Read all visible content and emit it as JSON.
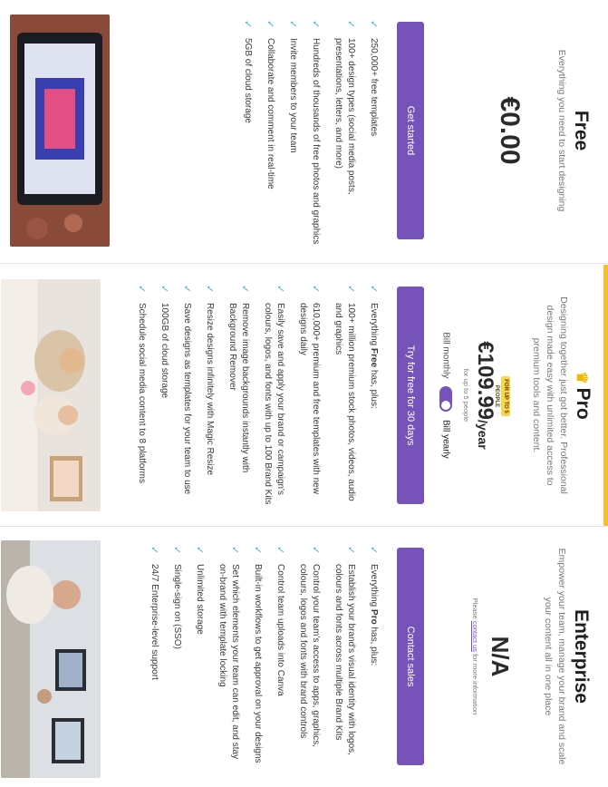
{
  "plans": [
    {
      "name": "Free",
      "description": "Everything you need to start designing",
      "price": "€0.00",
      "button": "Get started",
      "features": [
        "250,000+ free templates",
        "100+ design types (social media posts, presentations, letters, and more)",
        "Hundreds of thousands of free photos and graphics",
        "Invite members to your team",
        "Collaborate and comment in real-time",
        "5GB of cloud storage"
      ]
    },
    {
      "name": "Pro",
      "icon": "crown-icon",
      "description": "Designing together just got better. Professional design made easy with unlimited access to premium tools and content.",
      "badge": "FOR UP TO 5 PEOPLE",
      "price": "€109.99",
      "price_unit": "/year",
      "price_note": "for up to 5 people",
      "billing_monthly": "Bill monthly",
      "billing_yearly": "Bill yearly",
      "button": "Try for free for 30 days",
      "features_intro_prefix": "Everything ",
      "features_intro_bold": "Free",
      "features_intro_suffix": " has, plus:",
      "features": [
        "100+ million premium stock photos, videos, audio and graphics",
        "610,000+ premium and free templates with new designs daily",
        "Easily save and apply your brand or campaign's colours, logos, and fonts with up to 100 Brand Kits",
        "Remove image backgrounds instantly with Background Remover",
        "Resize designs infinitely with Magic Resize",
        "Save designs as templates for your team to use",
        "100GB of cloud storage",
        "Schedule social media content to 8 platforms"
      ]
    },
    {
      "name": "Enterprise",
      "description": "Empower your team, manage your brand and scale your content all in one place",
      "price": "N/A",
      "contact_prefix": "Please ",
      "contact_link": "contact us",
      "contact_suffix": " for more information",
      "button": "Contact sales",
      "features_intro_prefix": "Everything ",
      "features_intro_bold": "Pro",
      "features_intro_suffix": " has, plus:",
      "features": [
        "Establish your brand's visual identity with logos, colours and fonts across multiple Brand Kits",
        "Control your team's access to apps, graphics, colours, logos and fonts with brand controls",
        "Control team uploads into Canva",
        "Built-in workflows to get approval on your designs",
        "Set which elements your team can edit, and stay on-brand with template locking",
        "Unlimited storage",
        "Single-sign on (SSO)",
        "24/7 Enterprise-level support"
      ]
    }
  ],
  "colors": {
    "accent": "#7653b8",
    "check": "#3fb6c6",
    "highlight": "#f7c02f"
  }
}
